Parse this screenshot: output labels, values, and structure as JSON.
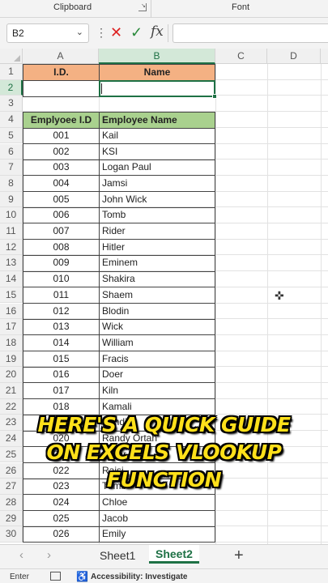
{
  "ribbon": {
    "clipboard_label": "Clipboard",
    "font_label": "Font"
  },
  "formula_bar": {
    "name_box": "B2",
    "fx_label": "fx",
    "formula": ""
  },
  "columns": [
    "A",
    "B",
    "C",
    "D"
  ],
  "selected_column": "B",
  "selected_row": 2,
  "row_numbers": [
    "1",
    "2",
    "3",
    "4",
    "5",
    "6",
    "7",
    "8",
    "9",
    "10",
    "11",
    "12",
    "13",
    "14",
    "15",
    "16",
    "17",
    "18",
    "19",
    "20",
    "21",
    "22",
    "23",
    "24",
    "25",
    "26",
    "27",
    "28",
    "29",
    "30"
  ],
  "lookup_header": {
    "id": "I.D.",
    "name": "Name"
  },
  "table_header": {
    "id": "Emplyoee I.D",
    "name": "Employee Name"
  },
  "employees": [
    {
      "id": "001",
      "name": "Kail"
    },
    {
      "id": "002",
      "name": "KSI"
    },
    {
      "id": "003",
      "name": "Logan Paul"
    },
    {
      "id": "004",
      "name": "Jamsi"
    },
    {
      "id": "005",
      "name": "John Wick"
    },
    {
      "id": "006",
      "name": "Tomb"
    },
    {
      "id": "007",
      "name": "Rider"
    },
    {
      "id": "008",
      "name": "Hitler"
    },
    {
      "id": "009",
      "name": "Eminem"
    },
    {
      "id": "010",
      "name": "Shakira"
    },
    {
      "id": "011",
      "name": "Shaem"
    },
    {
      "id": "012",
      "name": "Blodin"
    },
    {
      "id": "013",
      "name": "Wick"
    },
    {
      "id": "014",
      "name": "William"
    },
    {
      "id": "015",
      "name": "Fracis"
    },
    {
      "id": "016",
      "name": "Doer"
    },
    {
      "id": "017",
      "name": "Kiln"
    },
    {
      "id": "018",
      "name": "Kamali"
    },
    {
      "id": "019",
      "name": "Pandi"
    },
    {
      "id": "020",
      "name": "Randy Ortan"
    },
    {
      "id": "021",
      "name": "Omar"
    },
    {
      "id": "022",
      "name": "Raisi"
    },
    {
      "id": "023",
      "name": "Tumb"
    },
    {
      "id": "024",
      "name": "Chloe"
    },
    {
      "id": "025",
      "name": "Jacob"
    },
    {
      "id": "026",
      "name": "Emily"
    }
  ],
  "caption": [
    "HERE'S A QUICK GUIDE",
    "ON EXCELS VLOOKUP",
    "FUNCTION"
  ],
  "sheet_tabs": {
    "tabs": [
      "Sheet1",
      "Sheet2"
    ],
    "active": "Sheet2",
    "add_label": "+"
  },
  "status_bar": {
    "mode": "Enter",
    "accessibility": "Accessibility: Investigate"
  },
  "colors": {
    "accent": "#1e7145",
    "lookup_header": "#f4b183",
    "table_header": "#a9d18e",
    "caption_text": "#ffe01a"
  }
}
